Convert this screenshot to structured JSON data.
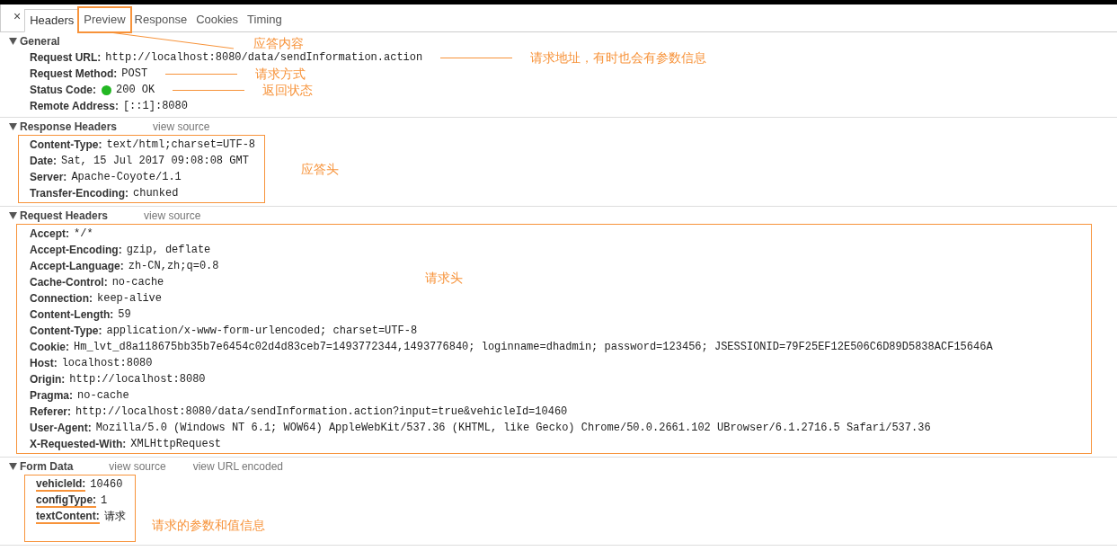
{
  "close_label": "×",
  "tabs": [
    {
      "label": "Headers",
      "selected": true,
      "annotated": false
    },
    {
      "label": "Preview",
      "selected": false,
      "annotated": true,
      "note": "应答内容"
    },
    {
      "label": "Response",
      "selected": false,
      "annotated": false
    },
    {
      "label": "Cookies",
      "selected": false,
      "annotated": false
    },
    {
      "label": "Timing",
      "selected": false,
      "annotated": false
    }
  ],
  "sections": [
    {
      "title": "General",
      "expanded": true,
      "boxed": false,
      "rows": [
        {
          "kind": "text",
          "key": "Request URL:",
          "value": "http://localhost:8080/data/sendInformation.action",
          "note": "请求地址，有时也会有参数信息",
          "leader": true
        },
        {
          "kind": "text",
          "key": "Request Method:",
          "value": "POST",
          "note": "请求方式",
          "leader": true
        },
        {
          "kind": "status",
          "key": "Status Code:",
          "value": "200 OK",
          "color": "#22b722",
          "note": "返回状态",
          "leader": true
        },
        {
          "kind": "text",
          "key": "Remote Address:",
          "value": "[::1]:8080"
        }
      ]
    },
    {
      "title": "Response Headers",
      "expanded": true,
      "links": [
        "view source"
      ],
      "boxed": true,
      "note": "应答头",
      "rows": [
        {
          "kind": "text",
          "key": "Content-Type:",
          "value": "text/html;charset=UTF-8"
        },
        {
          "kind": "text",
          "key": "Date:",
          "value": "Sat, 15 Jul 2017 09:08:08 GMT"
        },
        {
          "kind": "text",
          "key": "Server:",
          "value": "Apache-Coyote/1.1"
        },
        {
          "kind": "text",
          "key": "Transfer-Encoding:",
          "value": "chunked"
        }
      ]
    },
    {
      "title": "Request Headers",
      "expanded": true,
      "links": [
        "view source"
      ],
      "boxed": true,
      "rows": [
        {
          "kind": "text",
          "key": "Accept:",
          "value": "*/*"
        },
        {
          "kind": "text",
          "key": "Accept-Encoding:",
          "value": "gzip, deflate"
        },
        {
          "kind": "text",
          "key": "Accept-Language:",
          "value": "zh-CN,zh;q=0.8"
        },
        {
          "kind": "text",
          "key": "Cache-Control:",
          "value": "no-cache",
          "note": "请求头",
          "leader": false
        },
        {
          "kind": "text",
          "key": "Connection:",
          "value": "keep-alive"
        },
        {
          "kind": "text",
          "key": "Content-Length:",
          "value": "59"
        },
        {
          "kind": "text",
          "key": "Content-Type:",
          "value": "application/x-www-form-urlencoded; charset=UTF-8"
        },
        {
          "kind": "text",
          "key": "Cookie:",
          "value": "Hm_lvt_d8a118675bb35b7e6454c02d4d83ceb7=1493772344,1493776840; loginname=dhadmin; password=123456; JSESSIONID=79F25EF12E506C6D89D5838ACF15646A"
        },
        {
          "kind": "text",
          "key": "Host:",
          "value": "localhost:8080"
        },
        {
          "kind": "text",
          "key": "Origin:",
          "value": "http://localhost:8080"
        },
        {
          "kind": "text",
          "key": "Pragma:",
          "value": "no-cache"
        },
        {
          "kind": "text",
          "key": "Referer:",
          "value": "http://localhost:8080/data/sendInformation.action?input=true&vehicleId=10460"
        },
        {
          "kind": "text",
          "key": "User-Agent:",
          "value": "Mozilla/5.0 (Windows NT 6.1; WOW64) AppleWebKit/537.36 (KHTML, like Gecko) Chrome/50.0.2661.102 UBrowser/6.1.2716.5 Safari/537.36"
        },
        {
          "kind": "text",
          "key": "X-Requested-With:",
          "value": "XMLHttpRequest"
        }
      ]
    },
    {
      "title": "Form Data",
      "expanded": true,
      "links": [
        "view source",
        "view URL encoded"
      ],
      "boxed": true,
      "underline_keys": true,
      "note": "请求的参数和值信息",
      "rows": [
        {
          "kind": "text",
          "key": "vehicleId:",
          "value": "10460"
        },
        {
          "kind": "text",
          "key": "configType:",
          "value": "1"
        },
        {
          "kind": "text",
          "key": "textContent:",
          "value": "请求"
        }
      ]
    }
  ]
}
